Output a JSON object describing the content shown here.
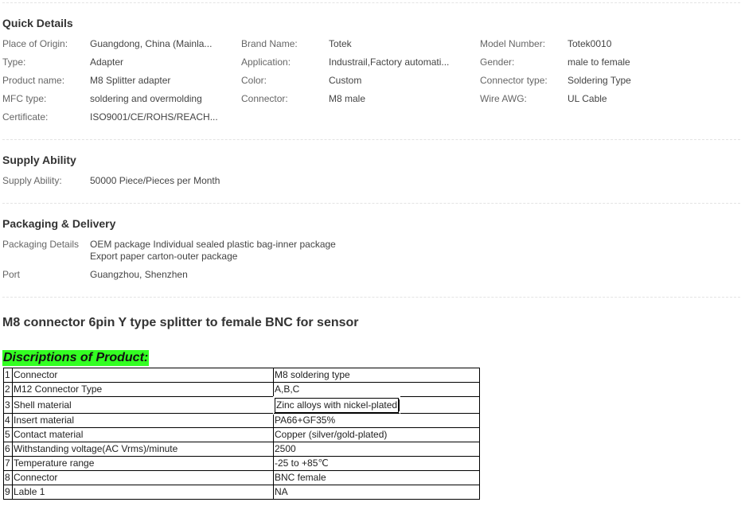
{
  "quick_details": {
    "title": "Quick Details",
    "fields": [
      {
        "label": "Place of Origin:",
        "value": "Guangdong, China (Mainla..."
      },
      {
        "label": "Brand Name:",
        "value": "Totek"
      },
      {
        "label": "Model Number:",
        "value": "Totek0010"
      },
      {
        "label": "Type:",
        "value": "Adapter"
      },
      {
        "label": "Application:",
        "value": "Industrail,Factory automati..."
      },
      {
        "label": "Gender:",
        "value": "male to female"
      },
      {
        "label": "Product name:",
        "value": "M8 Splitter adapter"
      },
      {
        "label": "Color:",
        "value": "Custom"
      },
      {
        "label": "Connector type:",
        "value": "Soldering Type"
      },
      {
        "label": "MFC type:",
        "value": "soldering and overmolding"
      },
      {
        "label": "Connector:",
        "value": "M8 male"
      },
      {
        "label": "Wire AWG:",
        "value": "UL Cable"
      },
      {
        "label": "Certificate:",
        "value": "ISO9001/CE/ROHS/REACH..."
      }
    ]
  },
  "supply_ability": {
    "title": "Supply Ability",
    "label": "Supply Ability:",
    "value": "50000 Piece/Pieces per Month"
  },
  "packaging": {
    "title": "Packaging & Delivery",
    "details_label": "Packaging Details",
    "details_line1": "OEM package Individual sealed plastic bag-inner package",
    "details_line2": "Export paper carton-outer package",
    "port_label": "Port",
    "port_value": "Guangzhou, Shenzhen"
  },
  "product_title": "M8 connector 6pin Y type splitter to female BNC for sensor",
  "discriptions_heading": "Discriptions of Product:",
  "spec_rows": [
    {
      "num": "1",
      "key": "Connector",
      "value": "M8 soldering type"
    },
    {
      "num": "2",
      "key": "M12 Connector Type",
      "value": "A,B,C"
    },
    {
      "num": "3",
      "key": "Shell material",
      "value": "Zinc alloys with nickel-plated"
    },
    {
      "num": "4",
      "key": "Insert material",
      "value": "PA66+GF35%"
    },
    {
      "num": "5",
      "key": "Contact material",
      "value": "Copper (silver/gold-plated)"
    },
    {
      "num": "6",
      "key": "Withstanding voltage(AC Vrms)/minute",
      "value": "2500"
    },
    {
      "num": "7",
      "key": "Temperature range",
      "value": "-25 to +85℃"
    },
    {
      "num": "8",
      "key": "Connector",
      "value": "BNC female"
    },
    {
      "num": "9",
      "key": "Lable 1",
      "value": "NA"
    }
  ]
}
